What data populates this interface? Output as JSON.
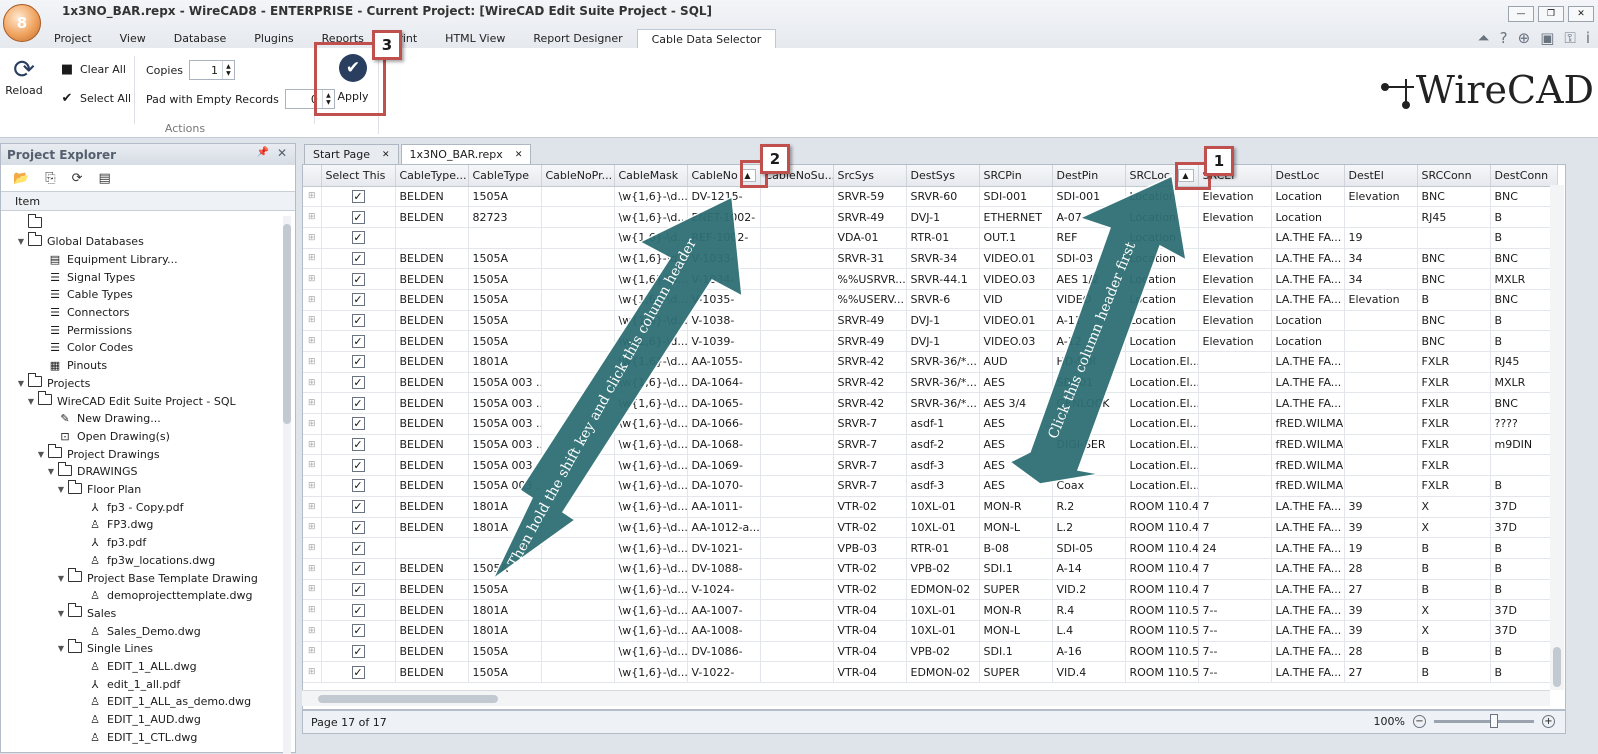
{
  "window": {
    "title": "1x3NO_BAR.repx - WireCAD8 - ENTERPRISE - Current Project: [WireCAD Edit Suite Project - SQL]",
    "orb_label": "8"
  },
  "menu": [
    "Project",
    "View",
    "Database",
    "Plugins",
    "Reports",
    "Print",
    "HTML View",
    "Report Designer",
    "Cable Data Selector"
  ],
  "ribbon": {
    "reload_label": "Reload",
    "clear_all_label": "Clear All",
    "select_all_label": "Select All",
    "copies_label": "Copies",
    "copies_value": "1",
    "pad_label": "Pad with Empty Records",
    "pad_value": "0",
    "apply_label": "Apply",
    "group_label": "Actions"
  },
  "logo_text": "WireCAD",
  "callouts": [
    "1",
    "2",
    "3"
  ],
  "annotations": {
    "arrow_1_text": "Click this column header first",
    "arrow_2_text": "Then hold the shift key and click this column header"
  },
  "explorer": {
    "title": "Project Explorer",
    "column_header": "Item",
    "items": [
      {
        "label": "",
        "icon": "folder-icon",
        "depth": 0,
        "toggle": ""
      },
      {
        "label": "Global Databases",
        "icon": "folder-icon",
        "depth": 0,
        "toggle": "▼"
      },
      {
        "label": "Equipment Library...",
        "icon": "library-icon",
        "depth": 2,
        "toggle": ""
      },
      {
        "label": "Signal Types",
        "icon": "list-icon",
        "depth": 2,
        "toggle": ""
      },
      {
        "label": "Cable Types",
        "icon": "list-icon",
        "depth": 2,
        "toggle": ""
      },
      {
        "label": "Connectors",
        "icon": "list-icon",
        "depth": 2,
        "toggle": ""
      },
      {
        "label": "Permissions",
        "icon": "list-icon",
        "depth": 2,
        "toggle": ""
      },
      {
        "label": "Color Codes",
        "icon": "list-icon",
        "depth": 2,
        "toggle": ""
      },
      {
        "label": "Pinouts",
        "icon": "pinout-icon",
        "depth": 2,
        "toggle": ""
      },
      {
        "label": "Projects",
        "icon": "folder-icon",
        "depth": 0,
        "toggle": "▼"
      },
      {
        "label": "WireCAD Edit Suite Project - SQL",
        "icon": "folder-icon",
        "depth": 1,
        "toggle": "▼"
      },
      {
        "label": "New Drawing...",
        "icon": "new-drawing-icon",
        "depth": 3,
        "toggle": ""
      },
      {
        "label": "Open Drawing(s)",
        "icon": "open-drawing-icon",
        "depth": 3,
        "toggle": ""
      },
      {
        "label": "Project Drawings",
        "icon": "folder-icon",
        "depth": 2,
        "toggle": "▼"
      },
      {
        "label": "DRAWINGS",
        "icon": "folder-icon",
        "depth": 3,
        "toggle": "▼"
      },
      {
        "label": "Floor Plan",
        "icon": "folder-icon",
        "depth": 4,
        "toggle": "▼"
      },
      {
        "label": "fp3 - Copy.pdf",
        "icon": "pdf-icon",
        "depth": 6,
        "toggle": ""
      },
      {
        "label": "FP3.dwg",
        "icon": "dwg-icon",
        "depth": 6,
        "toggle": ""
      },
      {
        "label": "fp3.pdf",
        "icon": "pdf-icon",
        "depth": 6,
        "toggle": ""
      },
      {
        "label": "fp3w_locations.dwg",
        "icon": "dwg-icon",
        "depth": 6,
        "toggle": ""
      },
      {
        "label": "Project Base Template Drawing",
        "icon": "folder-icon",
        "depth": 4,
        "toggle": "▼"
      },
      {
        "label": "demoprojecttemplate.dwg",
        "icon": "dwg-icon",
        "depth": 6,
        "toggle": ""
      },
      {
        "label": "Sales",
        "icon": "folder-icon",
        "depth": 4,
        "toggle": "▼"
      },
      {
        "label": "Sales_Demo.dwg",
        "icon": "dwg-icon",
        "depth": 6,
        "toggle": ""
      },
      {
        "label": "Single Lines",
        "icon": "folder-icon",
        "depth": 4,
        "toggle": "▼"
      },
      {
        "label": "EDIT_1_ALL.dwg",
        "icon": "dwg-icon",
        "depth": 6,
        "toggle": ""
      },
      {
        "label": "edit_1_all.pdf",
        "icon": "pdf-icon",
        "depth": 6,
        "toggle": ""
      },
      {
        "label": "EDIT_1_ALL_as_demo.dwg",
        "icon": "dwg-icon",
        "depth": 6,
        "toggle": ""
      },
      {
        "label": "EDIT_1_AUD.dwg",
        "icon": "dwg-icon",
        "depth": 6,
        "toggle": ""
      },
      {
        "label": "EDIT_1_CTL.dwg",
        "icon": "dwg-icon",
        "depth": 6,
        "toggle": ""
      }
    ]
  },
  "tabs": [
    {
      "label": "Start Page",
      "active": false
    },
    {
      "label": "1x3NO_BAR.repx",
      "active": true
    }
  ],
  "grid": {
    "columns": [
      "",
      "Select This",
      "CableType...",
      "CableType",
      "CableNoPr...",
      "CableMask",
      "CableNo",
      "CableNoSu...",
      "SrcSys",
      "DestSys",
      "SRCPin",
      "DestPin",
      "SRCLoc",
      "SRCEl",
      "DestLoc",
      "DestEl",
      "SRCConn",
      "DestConn"
    ],
    "rows": [
      [
        "BELDEN",
        "1505A",
        "",
        "\\w{1,6}-\\d...",
        "DV-1215-",
        "",
        "SRVR-59",
        "SRVR-60",
        "SDI-001",
        "SDI-001",
        "Location",
        "Elevation",
        "Location",
        "Elevation",
        "BNC",
        "BNC"
      ],
      [
        "BELDEN",
        "82723",
        "",
        "\\w{1,6}-\\d...",
        "ENET-1002-",
        "",
        "SRVR-49",
        "DVJ-1",
        "ETHERNET",
        "A-07",
        "Location",
        "Elevation",
        "Location",
        "",
        "RJ45",
        "B"
      ],
      [
        "",
        "",
        "",
        "\\w{1,6}-\\d...",
        "REF-1002-",
        "",
        "VDA-01",
        "RTR-01",
        "OUT.1",
        "REF",
        "Location",
        "",
        "LA.THE FA...",
        "19",
        "",
        "B"
      ],
      [
        "BELDEN",
        "1505A",
        "",
        "\\w{1,6}-\\d...",
        "V-1033-",
        "",
        "SRVR-31",
        "SRVR-34",
        "VIDEO.01",
        "SDI-03",
        "Location",
        "Elevation",
        "LA.THE FA...",
        "34",
        "BNC",
        "BNC"
      ],
      [
        "BELDEN",
        "1505A",
        "",
        "\\w{1,6}-\\d...",
        "V-1034-",
        "",
        "%%USRVR...",
        "SRVR-44.1",
        "VIDEO.03",
        "AES 1/2",
        "Location",
        "Elevation",
        "LA.THE FA...",
        "34",
        "BNC",
        "MXLR"
      ],
      [
        "BELDEN",
        "1505A",
        "",
        "\\w{1,6}-\\d...",
        "V-1035-",
        "",
        "%%USERV...",
        "SRVR-6",
        "VID",
        "VIDEO",
        "Location",
        "Elevation",
        "LA.THE FA...",
        "Elevation",
        "B",
        "BNC"
      ],
      [
        "BELDEN",
        "1505A",
        "",
        "\\w{1,6}-\\d...",
        "V-1038-",
        "",
        "SRVR-49",
        "DVJ-1",
        "VIDEO.01",
        "A-11",
        "Location",
        "Elevation",
        "Location",
        "",
        "BNC",
        "B"
      ],
      [
        "BELDEN",
        "1505A",
        "",
        "\\w{1,6}-\\d...",
        "V-1039-",
        "",
        "SRVR-49",
        "DVJ-1",
        "VIDEO.03",
        "A-12",
        "Location",
        "Elevation",
        "Location",
        "",
        "BNC",
        "B"
      ],
      [
        "BELDEN",
        "1801A",
        "",
        "\\w{1,6}-\\d...",
        "AA-1055-",
        "",
        "SRVR-42",
        "SRVR-36/*...",
        "AUD",
        "HD-SDI",
        "Location.El...",
        "",
        "LA.THE FA...",
        "",
        "FXLR",
        "RJ45"
      ],
      [
        "BELDEN",
        "1505A 003 ...",
        "",
        "\\w{1,6}-\\d...",
        "DA-1064-",
        "",
        "SRVR-42",
        "SRVR-36/*...",
        "AES",
        "SDI-01",
        "Location.El...",
        "",
        "LA.THE FA...",
        "",
        "FXLR",
        "MXLR"
      ],
      [
        "BELDEN",
        "1505A 003 ...",
        "",
        "\\w{1,6}-\\d...",
        "DA-1065-",
        "",
        "SRVR-42",
        "SRVR-36/*...",
        "AES 3/4",
        "GENLOCK",
        "Location.El...",
        "",
        "LA.THE FA...",
        "",
        "FXLR",
        "BNC"
      ],
      [
        "BELDEN",
        "1505A 003 ...",
        "",
        "\\w{1,6}-\\d...",
        "DA-1066-",
        "",
        "SRVR-7",
        "asdf-1",
        "AES",
        "",
        "Location.El...",
        "",
        "fRED.WILMA",
        "",
        "FXLR",
        "????"
      ],
      [
        "BELDEN",
        "1505A 003 ...",
        "",
        "\\w{1,6}-\\d...",
        "DA-1068-",
        "",
        "SRVR-7",
        "asdf-2",
        "AES",
        "DIGI-SER",
        "Location.El...",
        "",
        "fRED.WILMA",
        "",
        "FXLR",
        "m9DIN"
      ],
      [
        "BELDEN",
        "1505A 003 ...",
        "",
        "\\w{1,6}-\\d...",
        "DA-1069-",
        "",
        "SRVR-7",
        "asdf-3",
        "AES",
        "",
        "Location.El...",
        "",
        "fRED.WILMA",
        "",
        "FXLR",
        ""
      ],
      [
        "BELDEN",
        "1505A 003 ...",
        "",
        "\\w{1,6}-\\d...",
        "DA-1070-",
        "",
        "SRVR-7",
        "asdf-3",
        "AES",
        "Coax",
        "Location.El...",
        "",
        "fRED.WILMA",
        "",
        "FXLR",
        "B"
      ],
      [
        "BELDEN",
        "1801A",
        "",
        "\\w{1,6}-\\d...",
        "AA-1011-",
        "",
        "VTR-02",
        "10XL-01",
        "MON-R",
        "R.2",
        "ROOM 110.4",
        "7",
        "LA.THE FA...",
        "39",
        "X",
        "37D"
      ],
      [
        "BELDEN",
        "1801A",
        "",
        "\\w{1,6}-\\d...",
        "AA-1012-a...",
        "",
        "VTR-02",
        "10XL-01",
        "MON-L",
        "L.2",
        "ROOM 110.4",
        "7",
        "LA.THE FA...",
        "39",
        "X",
        "37D"
      ],
      [
        "",
        "",
        "",
        "\\w{1,6}-\\d...",
        "DV-1021-",
        "",
        "VPB-03",
        "RTR-01",
        "B-08",
        "SDI-05",
        "ROOM 110.4",
        "24",
        "LA.THE FA...",
        "19",
        "B",
        "B"
      ],
      [
        "BELDEN",
        "1505A",
        "",
        "\\w{1,6}-\\d...",
        "DV-1088-",
        "",
        "VTR-02",
        "VPB-02",
        "SDI.1",
        "A-14",
        "ROOM 110.4",
        "7",
        "LA.THE FA...",
        "28",
        "B",
        "B"
      ],
      [
        "BELDEN",
        "1505A",
        "",
        "\\w{1,6}-\\d...",
        "V-1024-",
        "",
        "VTR-02",
        "EDMON-02",
        "SUPER",
        "VID.2",
        "ROOM 110.4",
        "7",
        "LA.THE FA...",
        "27",
        "B",
        "B"
      ],
      [
        "BELDEN",
        "1801A",
        "",
        "\\w{1,6}-\\d...",
        "AA-1007-",
        "",
        "VTR-04",
        "10XL-01",
        "MON-R",
        "R.4",
        "ROOM 110.5",
        "7--",
        "LA.THE FA...",
        "39",
        "X",
        "37D"
      ],
      [
        "BELDEN",
        "1801A",
        "",
        "\\w{1,6}-\\d...",
        "AA-1008-",
        "",
        "VTR-04",
        "10XL-01",
        "MON-L",
        "L.4",
        "ROOM 110.5",
        "7--",
        "LA.THE FA...",
        "39",
        "X",
        "37D"
      ],
      [
        "BELDEN",
        "1505A",
        "",
        "\\w{1,6}-\\d...",
        "DV-1086-",
        "",
        "VTR-04",
        "VPB-02",
        "SDI.1",
        "A-16",
        "ROOM 110.5",
        "7--",
        "LA.THE FA...",
        "28",
        "B",
        "B"
      ],
      [
        "BELDEN",
        "1505A",
        "",
        "\\w{1,6}-\\d...",
        "V-1022-",
        "",
        "VTR-04",
        "EDMON-02",
        "SUPER",
        "VID.4",
        "ROOM 110.5",
        "7--",
        "LA.THE FA...",
        "27",
        "B",
        "B"
      ]
    ]
  },
  "status": {
    "page_text": "Page 17 of 17",
    "zoom_text": "100%"
  },
  "colors": {
    "callout_border": "#c0504d",
    "arrow_fill": "#2e6f74",
    "accent": "#2a3f5f"
  }
}
